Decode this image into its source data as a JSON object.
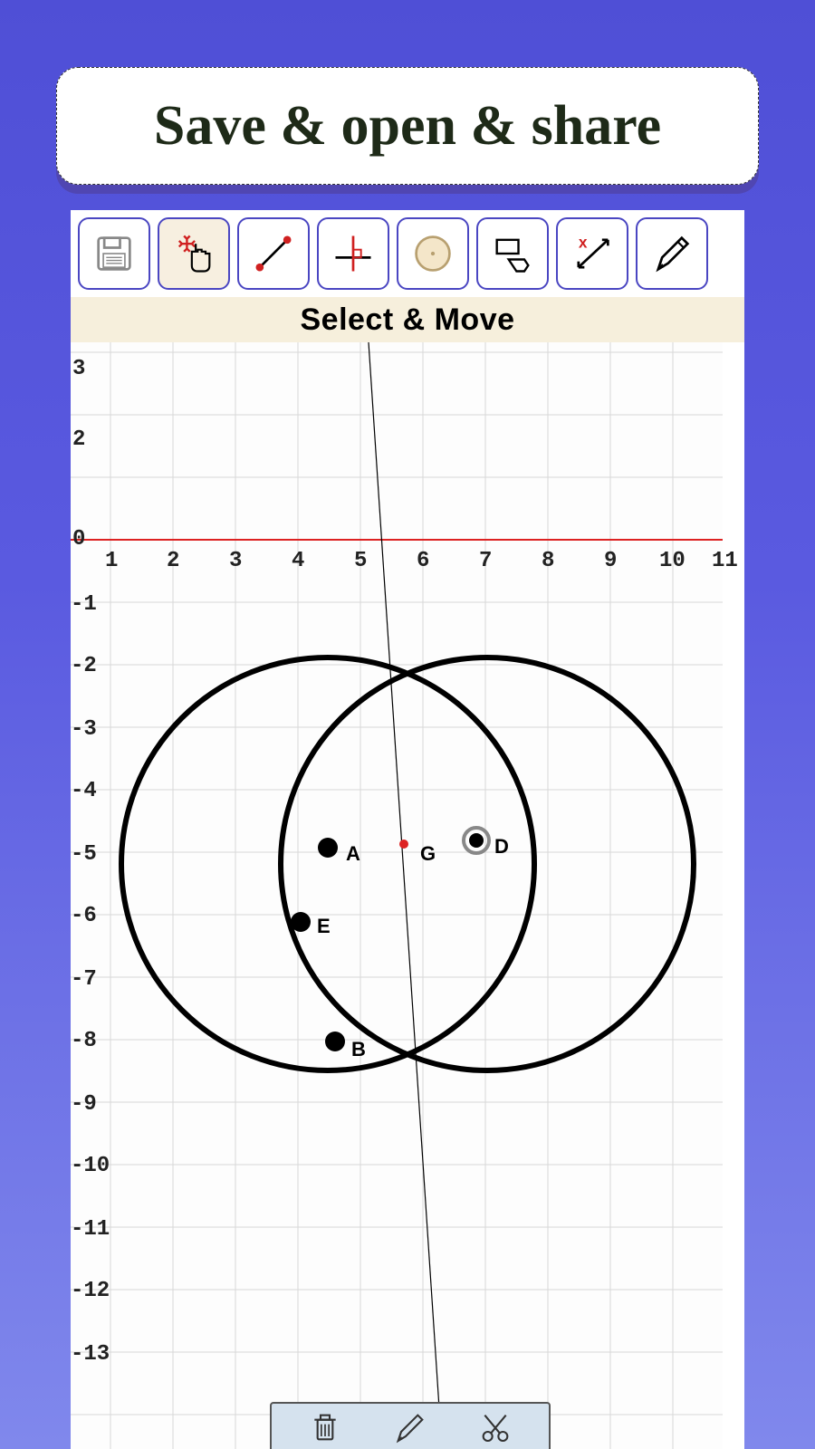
{
  "header": {
    "title": "Save & open & share"
  },
  "tools": [
    {
      "name": "save",
      "active": false
    },
    {
      "name": "select-move",
      "active": true
    },
    {
      "name": "line",
      "active": false
    },
    {
      "name": "perpendicular",
      "active": false
    },
    {
      "name": "circle",
      "active": false
    },
    {
      "name": "polygon",
      "active": false
    },
    {
      "name": "measure",
      "active": false
    },
    {
      "name": "pencil",
      "active": false
    }
  ],
  "status": {
    "current_tool_label": "Select & Move"
  },
  "axes": {
    "y_ticks": [
      "3",
      "2",
      "0",
      "-1",
      "-2",
      "-3",
      "-4",
      "-5",
      "-6",
      "-7",
      "-8",
      "-9",
      "-10",
      "-11",
      "-12",
      "-13"
    ],
    "x_ticks": [
      "1",
      "2",
      "3",
      "4",
      "5",
      "6",
      "7",
      "8",
      "9",
      "10",
      "11"
    ]
  },
  "points": {
    "A": "A",
    "G": "G",
    "D": "D",
    "E": "E",
    "B": "B"
  },
  "bottom_actions": [
    "delete",
    "edit",
    "cut"
  ]
}
